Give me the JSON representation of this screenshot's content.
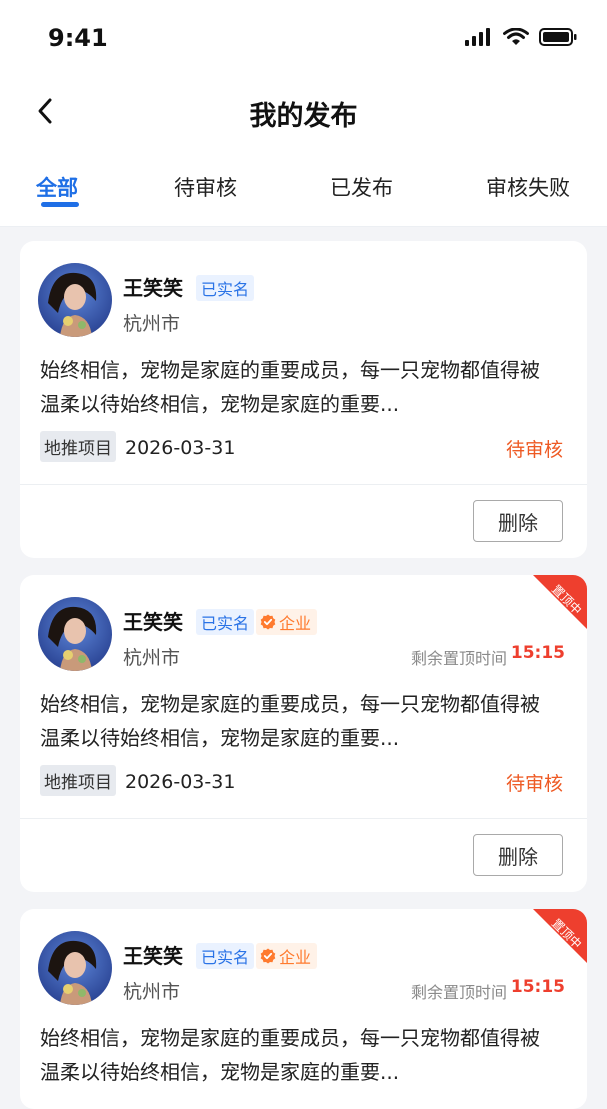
{
  "status_bar": {
    "time": "9:41"
  },
  "nav": {
    "title": "我的发布"
  },
  "tabs": [
    "全部",
    "待审核",
    "已发布",
    "审核失败"
  ],
  "cards": [
    {
      "name": "王笑笑",
      "verified": "已实名",
      "enterprise": "",
      "city": "杭州市",
      "pin_label": "",
      "pin_time": "",
      "content": "始终相信，宠物是家庭的重要成员，每一只宠物都值得被温柔以待始终相信，宠物是家庭的重要...",
      "tag": "地推项目",
      "date": "2026-03-31",
      "status": "待审核",
      "delete_label": "删除",
      "ribbon": ""
    },
    {
      "name": "王笑笑",
      "verified": "已实名",
      "enterprise": "企业",
      "city": "杭州市",
      "pin_label": "剩余置顶时间",
      "pin_time": "15:15",
      "content": "始终相信，宠物是家庭的重要成员，每一只宠物都值得被温柔以待始终相信，宠物是家庭的重要...",
      "tag": "地推项目",
      "date": "2026-03-31",
      "status": "待审核",
      "delete_label": "删除",
      "ribbon": "置顶中"
    },
    {
      "name": "王笑笑",
      "verified": "已实名",
      "enterprise": "企业",
      "city": "杭州市",
      "pin_label": "剩余置顶时间",
      "pin_time": "15:15",
      "content": "始终相信，宠物是家庭的重要成员，每一只宠物都值得被温柔以待始终相信，宠物是家庭的重要...",
      "tag": "",
      "date": "",
      "status": "",
      "delete_label": "",
      "ribbon": "置顶中"
    }
  ],
  "colors": {
    "accent": "#1f6fe6",
    "warning": "#ee5a24",
    "pin": "#ee3f2e"
  }
}
